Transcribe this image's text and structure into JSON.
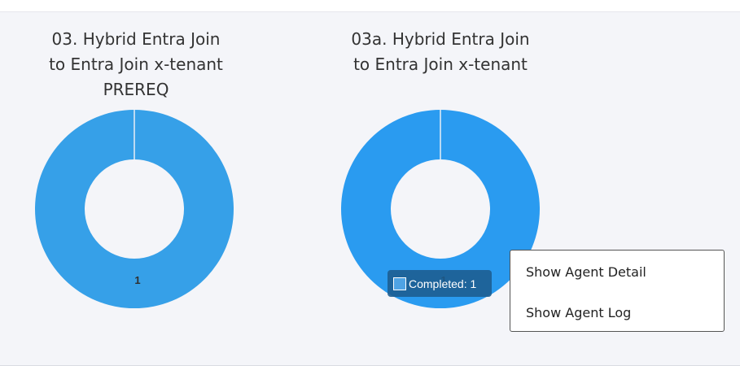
{
  "charts": [
    {
      "title_lines": [
        "03. Hybrid Entra Join",
        "to Entra Join x-tenant",
        "PREREQ"
      ],
      "chart_data": {
        "type": "pie",
        "categories": [
          "Completed"
        ],
        "values": [
          1
        ],
        "data_labels": [
          "1"
        ],
        "title": "03. Hybrid Entra Join to Entra Join x-tenant PREREQ"
      }
    },
    {
      "title_lines": [
        "03a. Hybrid Entra Join",
        "to Entra Join x-tenant"
      ],
      "chart_data": {
        "type": "pie",
        "categories": [
          "Completed"
        ],
        "values": [
          1
        ],
        "data_labels": [
          "1"
        ],
        "title": "03a. Hybrid Entra Join to Entra Join x-tenant"
      }
    }
  ],
  "tooltip": {
    "text": "Completed: 1"
  },
  "context_menu": {
    "items": [
      "Show Agent Detail",
      "Show Agent Log"
    ]
  },
  "colors": {
    "slice_a": "#36a0e8",
    "slice_b": "#2a9bf0",
    "divider": "#e8eef5",
    "label": "#2f2f2f"
  }
}
